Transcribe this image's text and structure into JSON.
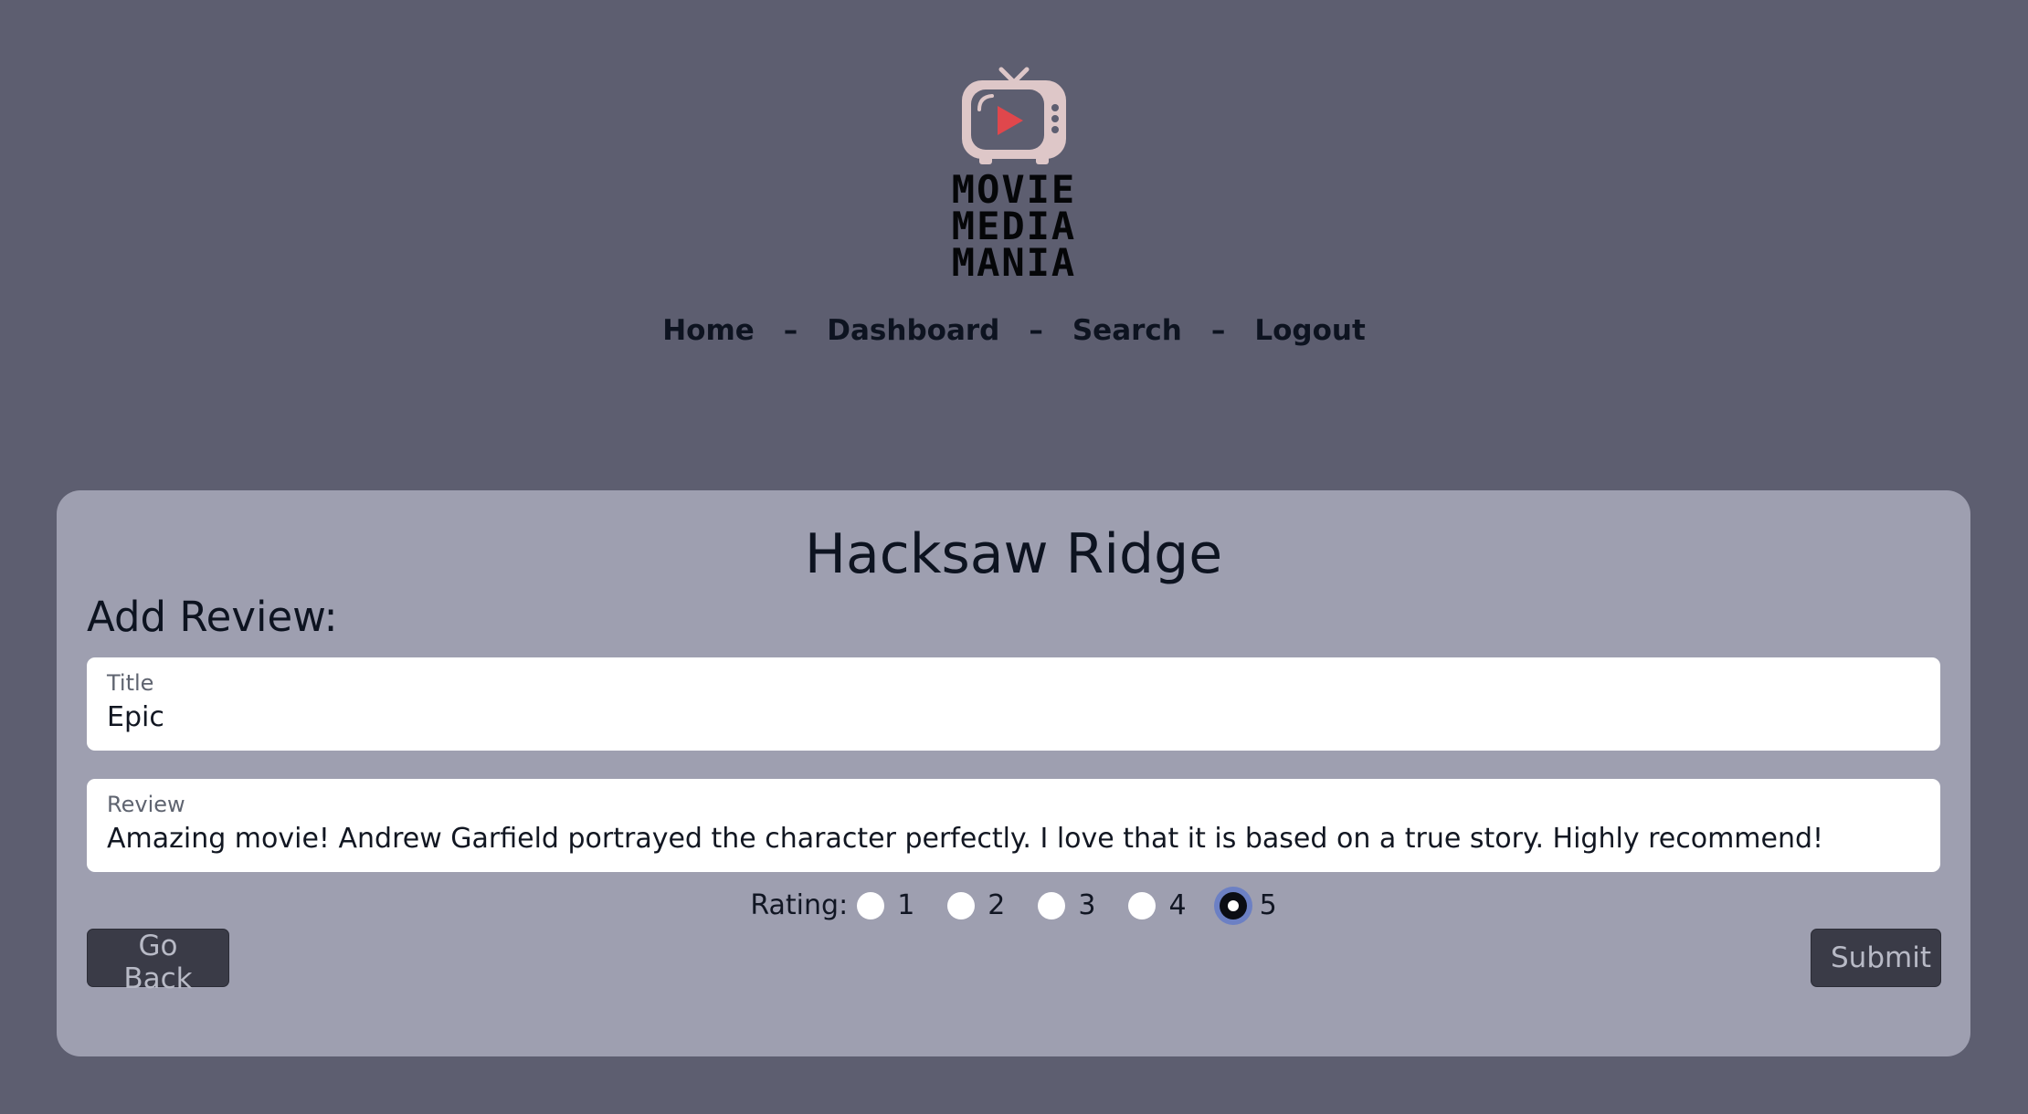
{
  "logo": {
    "icon": "tv-play-icon",
    "lines": [
      "MOVIE",
      "MEDIA",
      "MANIA"
    ],
    "colors": {
      "tv": "#dec7c8",
      "play": "#e0474c",
      "text": "#050608"
    }
  },
  "nav": {
    "items": [
      {
        "label": "Home"
      },
      {
        "label": "Dashboard"
      },
      {
        "label": "Search"
      },
      {
        "label": "Logout"
      }
    ],
    "separator": "–"
  },
  "card": {
    "movie_title": "Hacksaw Ridge",
    "heading": "Add Review:",
    "title_field": {
      "label": "Title",
      "value": "Epic"
    },
    "review_field": {
      "label": "Review",
      "value": "Amazing movie! Andrew Garfield portrayed the character perfectly. I love that it is based on a true story. Highly recommend!"
    },
    "rating": {
      "label": "Rating:",
      "options": [
        "1",
        "2",
        "3",
        "4",
        "5"
      ],
      "selected": "5"
    },
    "buttons": {
      "back": "Go Back",
      "submit": "Submit"
    }
  },
  "colors": {
    "background": "#5d5e70",
    "card": "#9e9fb0",
    "button": "#3a3b47",
    "radio_focus": "#6c80c4"
  }
}
